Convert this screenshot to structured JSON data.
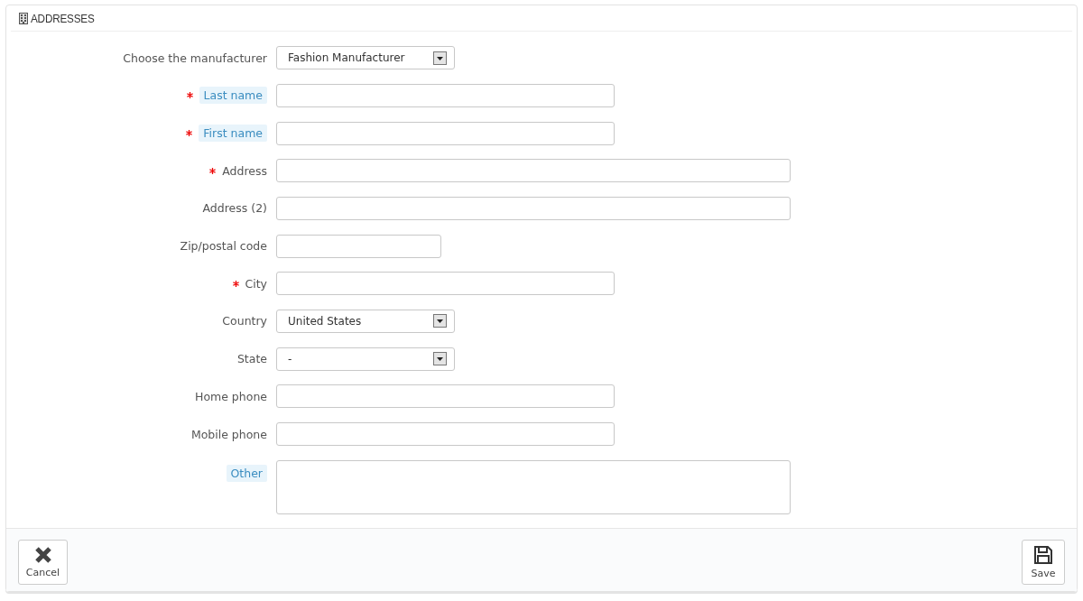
{
  "panel": {
    "title": "ADDRESSES"
  },
  "fields": [
    {
      "kind": "select",
      "label": "Choose the manufacturer",
      "required": false,
      "hint": false,
      "value": "Fashion Manufacturer"
    },
    {
      "kind": "text",
      "label": "Last name",
      "required": true,
      "hint": true
    },
    {
      "kind": "text",
      "label": "First name",
      "required": true,
      "hint": true
    },
    {
      "kind": "text",
      "label": "Address",
      "required": true,
      "hint": false
    },
    {
      "kind": "text",
      "label": "Address (2)",
      "required": false,
      "hint": false
    },
    {
      "kind": "text",
      "label": "Zip/postal code",
      "required": false,
      "hint": false
    },
    {
      "kind": "text",
      "label": "City",
      "required": true,
      "hint": false
    },
    {
      "kind": "select",
      "label": "Country",
      "required": false,
      "hint": false,
      "value": "United States"
    },
    {
      "kind": "select",
      "label": "State",
      "required": false,
      "hint": false,
      "value": "-"
    },
    {
      "kind": "text",
      "label": "Home phone",
      "required": false,
      "hint": false
    },
    {
      "kind": "text",
      "label": "Mobile phone",
      "required": false,
      "hint": false
    },
    {
      "kind": "textarea",
      "label": "Other",
      "required": false,
      "hint": true
    }
  ],
  "footer": {
    "cancel": "Cancel",
    "save": "Save"
  }
}
